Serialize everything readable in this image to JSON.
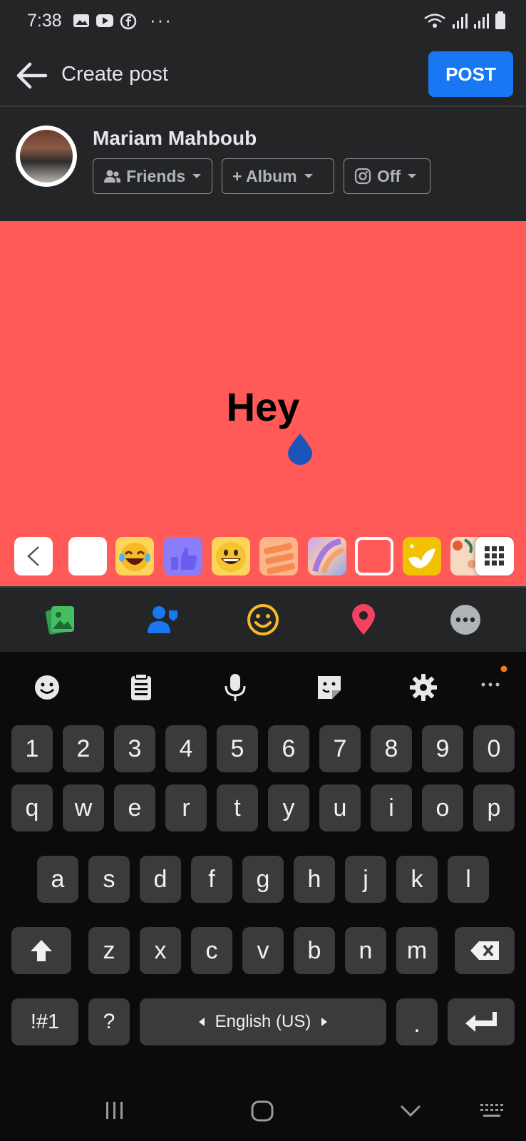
{
  "status_bar": {
    "time": "7:38",
    "overflow": "···"
  },
  "header": {
    "title": "Create post",
    "post_label": "POST"
  },
  "composer": {
    "user_name": "Mariam Mahboub",
    "audience_label": "Friends",
    "album_label": "+ Album",
    "instagram_label": "Off",
    "post_text": "Hey"
  },
  "keyboard": {
    "number_row": [
      "1",
      "2",
      "3",
      "4",
      "5",
      "6",
      "7",
      "8",
      "9",
      "0"
    ],
    "row1": [
      "q",
      "w",
      "e",
      "r",
      "t",
      "y",
      "u",
      "i",
      "o",
      "p"
    ],
    "row2": [
      "a",
      "s",
      "d",
      "f",
      "g",
      "h",
      "j",
      "k",
      "l"
    ],
    "row3": [
      "z",
      "x",
      "c",
      "v",
      "b",
      "n",
      "m"
    ],
    "symbols_label": "!#1",
    "question_label": "?",
    "space_label": "English (US)",
    "period_label": "."
  },
  "colors": {
    "accent": "#1877f2",
    "canvas_background": "#ff5a58",
    "surface": "#242526",
    "key": "#3b3b3d"
  },
  "icons": {
    "action_bar": [
      "photo-icon",
      "tag-people-icon",
      "feeling-icon",
      "location-icon",
      "more-icon"
    ],
    "keyboard_toolbar": [
      "emoji-icon",
      "clipboard-icon",
      "microphone-icon",
      "sticker-icon",
      "settings-icon",
      "more-options-icon"
    ]
  }
}
